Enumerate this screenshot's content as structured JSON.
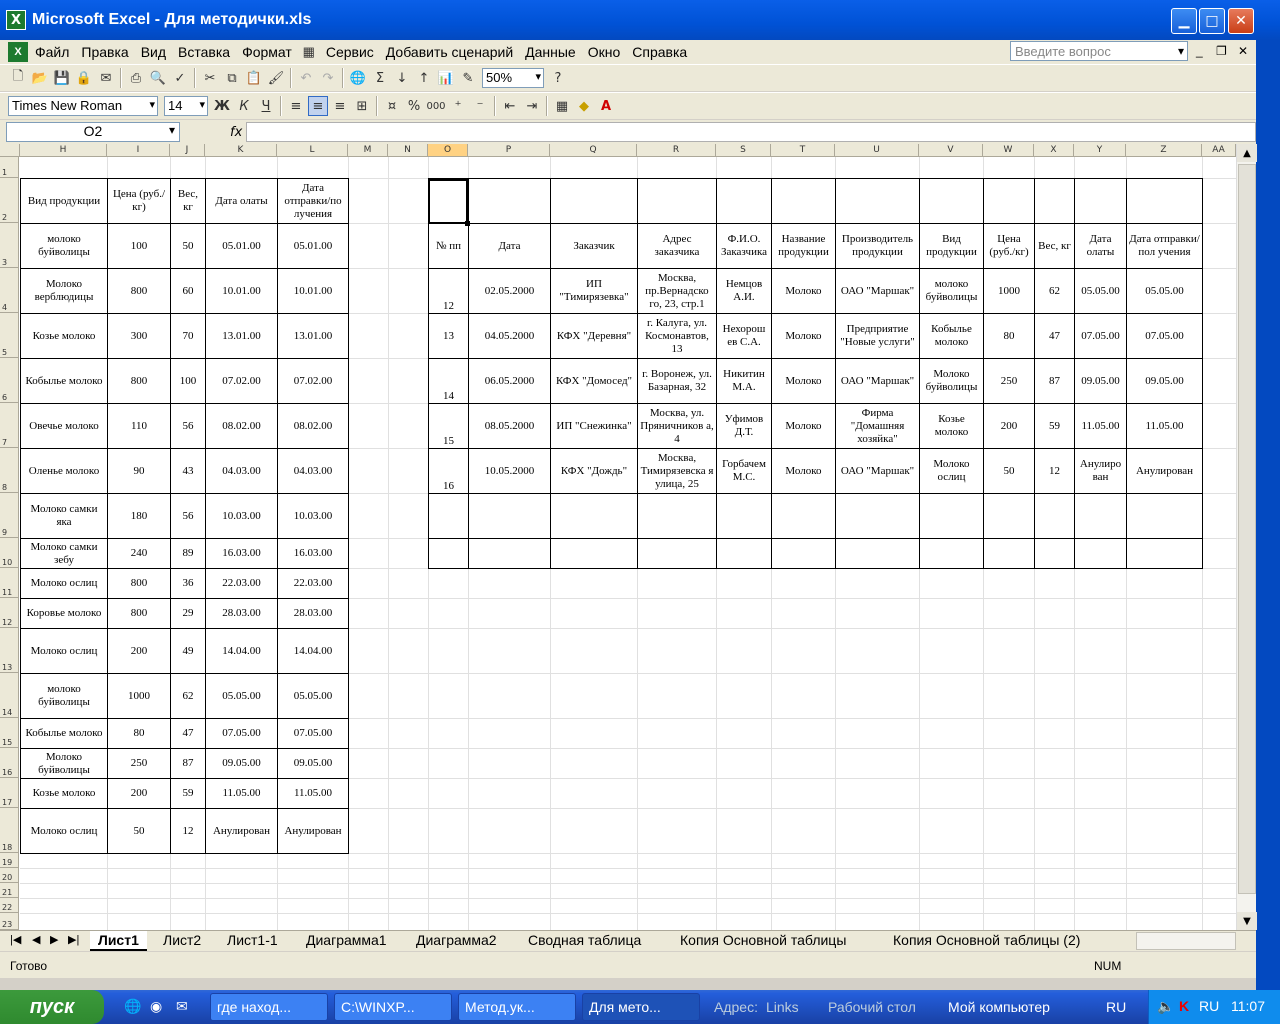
{
  "window": {
    "title": "Microsoft Excel - Для методички.xls",
    "minimize_label": "▁",
    "maximize_label": "□",
    "close_label": "✕"
  },
  "menu": {
    "items": [
      "Файл",
      "Правка",
      "Вид",
      "Вставка",
      "Формат",
      "Сервис",
      "Добавить сценарий",
      "Данные",
      "Окно",
      "Справка"
    ],
    "question_placeholder": "Введите вопрос"
  },
  "toolbar": {
    "zoom": "50%",
    "font_name": "Times New Roman",
    "font_size": "14",
    "bold": "Ж",
    "italic": "К",
    "underline": "Ч",
    "percent": "%",
    "thousands": "000",
    "sum": "Σ"
  },
  "formula_bar": {
    "name_box": "O2",
    "fx": "fx",
    "content": ""
  },
  "columns": [
    "H",
    "I",
    "J",
    "K",
    "L",
    "M",
    "N",
    "O",
    "P",
    "Q",
    "R",
    "S",
    "T",
    "U",
    "V",
    "W",
    "X",
    "Y",
    "Z",
    "AA"
  ],
  "rows": [
    "1",
    "2",
    "3",
    "4",
    "5",
    "6",
    "7",
    "8",
    "9",
    "10",
    "11",
    "12",
    "13",
    "14",
    "15",
    "16",
    "17",
    "18",
    "19",
    "20",
    "21",
    "22",
    "23"
  ],
  "table1": {
    "headers": [
      "Вид продукции",
      "Цена (руб./кг)",
      "Вес, кг",
      "Дата олаты",
      "Дата отправки/по лучения"
    ],
    "rows": [
      [
        "молоко буйволицы",
        "100",
        "50",
        "05.01.00",
        "05.01.00"
      ],
      [
        "Молоко верблюдицы",
        "800",
        "60",
        "10.01.00",
        "10.01.00"
      ],
      [
        "Козье молоко",
        "300",
        "70",
        "13.01.00",
        "13.01.00"
      ],
      [
        "Кобылье молоко",
        "800",
        "100",
        "07.02.00",
        "07.02.00"
      ],
      [
        "Овечье молоко",
        "110",
        "56",
        "08.02.00",
        "08.02.00"
      ],
      [
        "Оленье молоко",
        "90",
        "43",
        "04.03.00",
        "04.03.00"
      ],
      [
        "Молоко самки яка",
        "180",
        "56",
        "10.03.00",
        "10.03.00"
      ],
      [
        "Молоко самки зебу",
        "240",
        "89",
        "16.03.00",
        "16.03.00"
      ],
      [
        "Молоко ослиц",
        "800",
        "36",
        "22.03.00",
        "22.03.00"
      ],
      [
        "Коровье молоко",
        "800",
        "29",
        "28.03.00",
        "28.03.00"
      ],
      [
        "Молоко ослиц",
        "200",
        "49",
        "14.04.00",
        "14.04.00"
      ],
      [
        "молоко буйволицы",
        "1000",
        "62",
        "05.05.00",
        "05.05.00"
      ],
      [
        "Кобылье молоко",
        "80",
        "47",
        "07.05.00",
        "07.05.00"
      ],
      [
        "Молоко буйволицы",
        "250",
        "87",
        "09.05.00",
        "09.05.00"
      ],
      [
        "Козье молоко",
        "200",
        "59",
        "11.05.00",
        "11.05.00"
      ],
      [
        "Молоко ослиц",
        "50",
        "12",
        "Анулирован",
        "Анулирован"
      ]
    ]
  },
  "table2": {
    "headers": [
      "№ пп",
      "Дата",
      "Заказчик",
      "Адрес заказчика",
      "Ф.И.О. Заказчика",
      "Название продукции",
      "Производитель продукции",
      "Вид продукции",
      "Цена (руб./кг)",
      "Вес, кг",
      "Дата олаты",
      "Дата отправки/пол учения"
    ],
    "rows": [
      [
        "12",
        "02.05.2000",
        "ИП \"Тимирязевка\"",
        "Москва, пр.Вернадско го, 23, стр.1",
        "Немцов А.И.",
        "Молоко",
        "ОАО \"Маршак\"",
        "молоко буйволицы",
        "1000",
        "62",
        "05.05.00",
        "05.05.00"
      ],
      [
        "13",
        "04.05.2000",
        "КФХ \"Деревня\"",
        "г. Калуга, ул. Космонавтов, 13",
        "Нехорош ев С.А.",
        "Молоко",
        "Предприятие \"Новые услуги\"",
        "Кобылье молоко",
        "80",
        "47",
        "07.05.00",
        "07.05.00"
      ],
      [
        "14",
        "06.05.2000",
        "КФХ \"Домосед\"",
        "г. Воронеж, ул. Базарная, 32",
        "Никитин М.А.",
        "Молоко",
        "ОАО \"Маршак\"",
        "Молоко буйволицы",
        "250",
        "87",
        "09.05.00",
        "09.05.00"
      ],
      [
        "15",
        "08.05.2000",
        "ИП \"Снежинка\"",
        "Москва, ул. Пряничников а, 4",
        "Уфимов Д.Т.",
        "Молоко",
        "Фирма \"Домашняя хозяйка\"",
        "Козье молоко",
        "200",
        "59",
        "11.05.00",
        "11.05.00"
      ],
      [
        "16",
        "10.05.2000",
        "КФХ \"Дождь\"",
        "Москва, Тимирязевска я улица, 25",
        "Горбачем М.С.",
        "Молоко",
        "ОАО \"Маршак\"",
        "Молоко ослиц",
        "50",
        "12",
        "Анулиро ван",
        "Анулирован"
      ]
    ]
  },
  "sheet_tabs": [
    "Лист1",
    "Лист2",
    "Лист1-1",
    "Диаграмма1",
    "Диаграмма2",
    "Сводная таблица",
    "Копия Основной таблицы",
    "Копия Основной таблицы (2)"
  ],
  "status": {
    "ready": "Готово",
    "num": "NUM"
  },
  "taskbar": {
    "start": "пуск",
    "tasks": [
      "где наход...",
      "C:\\WINXP...",
      "Метод.ук...",
      "Для мето..."
    ],
    "address_label": "Адрес:",
    "links_label": "Links",
    "desktop": "Рабочий стол",
    "mycomputer": "Мой компьютер",
    "lang": "RU",
    "lang2": "RU",
    "clock": "11:07"
  }
}
